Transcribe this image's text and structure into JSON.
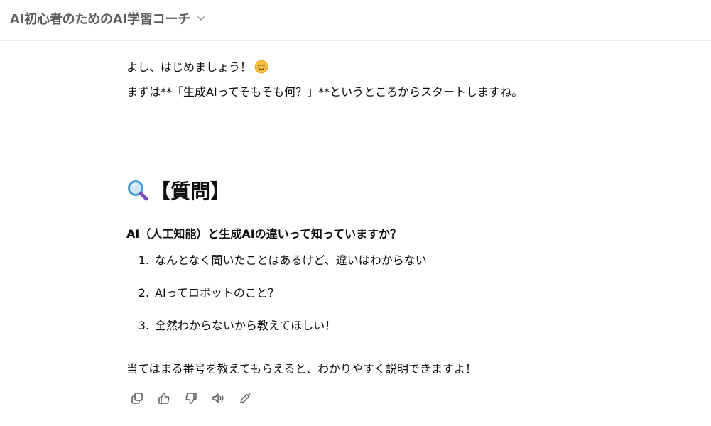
{
  "header": {
    "title": "AI初心者のためのAI学習コーチ",
    "chevron_icon": "chevron-down-icon"
  },
  "message": {
    "intro_line": "よし、はじめましょう！",
    "intro_emoji": "smiling-face-emoji",
    "second_line": "まずは**「生成AIってそもそも何？」**というところからスタートしますね。",
    "heading_icon": "magnifying-glass-icon",
    "heading": "【質問】",
    "question": "AI（人工知能）と生成AIの違いって知っていますか？",
    "options": [
      {
        "number": "1.",
        "text": "なんとなく聞いたことはあるけど、違いはわからない"
      },
      {
        "number": "2.",
        "text": "AIってロボットのこと？"
      },
      {
        "number": "3.",
        "text": "全然わからないから教えてほしい！"
      }
    ],
    "closing": "当てはまる番号を教えてもらえると、わかりやすく説明できますよ！"
  },
  "actions": [
    {
      "name": "copy-button",
      "icon": "copy-icon"
    },
    {
      "name": "thumbs-up-button",
      "icon": "thumbs-up-icon"
    },
    {
      "name": "thumbs-down-button",
      "icon": "thumbs-down-icon"
    },
    {
      "name": "read-aloud-button",
      "icon": "speaker-icon"
    },
    {
      "name": "edit-in-canvas-button",
      "icon": "pen-sparkle-icon"
    }
  ],
  "colors": {
    "title": "#5d5d5d",
    "text": "#0d0d0d",
    "divider": "#ececec",
    "icon": "#5d5d5d"
  }
}
